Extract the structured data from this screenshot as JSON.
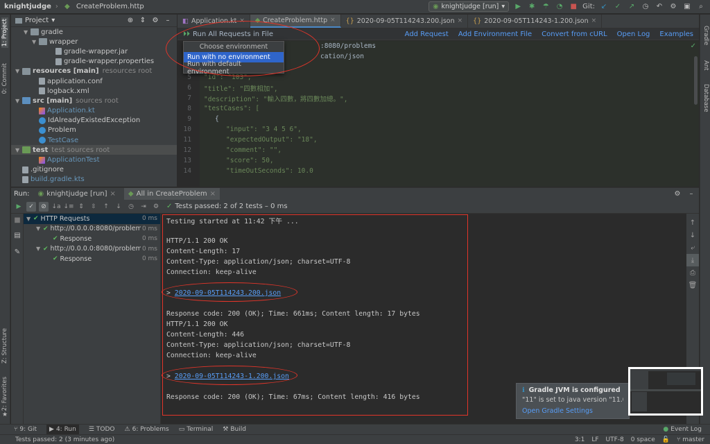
{
  "navbar": {
    "project": "knightjudge",
    "file": "CreateProblem.http",
    "run_config": "knightjudge [run]",
    "git_label": "Git:"
  },
  "left_stripe": {
    "project": "1: Project",
    "commit": "0: Commit",
    "structure": "Z: Structure",
    "favorites": "2: Favorites"
  },
  "right_stripe": {
    "gradle": "Gradle",
    "ant": "Ant",
    "database": "Database"
  },
  "project_panel": {
    "title": "Project",
    "items": [
      {
        "indent": 1,
        "arrow": "▼",
        "icon": "folder",
        "label": "gradle",
        "sub": ""
      },
      {
        "indent": 2,
        "arrow": "▼",
        "icon": "folder",
        "label": "wrapper",
        "sub": ""
      },
      {
        "indent": 4,
        "arrow": "",
        "icon": "file",
        "label": "gradle-wrapper.jar",
        "sub": ""
      },
      {
        "indent": 4,
        "arrow": "",
        "icon": "file",
        "label": "gradle-wrapper.properties",
        "sub": ""
      },
      {
        "indent": 0,
        "arrow": "▼",
        "icon": "folder",
        "label": "resources [main]",
        "sub": "resources root",
        "bold": true
      },
      {
        "indent": 2,
        "arrow": "",
        "icon": "file",
        "label": "application.conf",
        "sub": ""
      },
      {
        "indent": 2,
        "arrow": "",
        "icon": "file",
        "label": "logback.xml",
        "sub": ""
      },
      {
        "indent": 0,
        "arrow": "▼",
        "icon": "folder-blue",
        "label": "src [main]",
        "sub": "sources root",
        "bold": true
      },
      {
        "indent": 2,
        "arrow": "",
        "icon": "kt",
        "label": "Application.kt",
        "sub": "",
        "blue": true
      },
      {
        "indent": 2,
        "arrow": "",
        "icon": "class",
        "label": "IdAlreadyExistedException",
        "sub": ""
      },
      {
        "indent": 2,
        "arrow": "",
        "icon": "class",
        "label": "Problem",
        "sub": ""
      },
      {
        "indent": 2,
        "arrow": "",
        "icon": "class",
        "label": "TestCase",
        "sub": "",
        "blue": true
      },
      {
        "indent": 0,
        "arrow": "▼",
        "icon": "folder-green",
        "label": "test",
        "sub": "test sources root",
        "bold": true,
        "selected": true
      },
      {
        "indent": 2,
        "arrow": "",
        "icon": "kt",
        "label": "ApplicationTest",
        "sub": "",
        "blue": true
      },
      {
        "indent": 0,
        "arrow": "",
        "icon": "file",
        "label": ".gitignore",
        "sub": ""
      },
      {
        "indent": 0,
        "arrow": "",
        "icon": "file",
        "label": "build.gradle.kts",
        "sub": "",
        "blue": true
      }
    ]
  },
  "editor": {
    "tabs": [
      {
        "label": "Application.kt",
        "active": false
      },
      {
        "label": "CreateProblem.http",
        "active": true
      },
      {
        "label": "2020-09-05T114243.200.json",
        "active": false
      },
      {
        "label": "2020-09-05T114243-1.200.json",
        "active": false
      }
    ],
    "http_toolbar": {
      "run_all": "Run All Requests in File",
      "links": [
        "Add Request",
        "Add Environment File",
        "Convert from cURL",
        "Open Log",
        "Examples"
      ]
    },
    "lines": [
      {
        "n": "",
        "text": ":8080/problems",
        "cls": "p",
        "indent": 176
      },
      {
        "n": "",
        "text": "cation/json",
        "cls": "p",
        "indent": 176
      },
      {
        "n": "",
        "text": "",
        "cls": "p",
        "indent": 0
      },
      {
        "n": "5",
        "text": "\"id\": \"103\",",
        "cls": "s",
        "indent": 8
      },
      {
        "n": "6",
        "text": "\"title\": \"四數相加\",",
        "cls": "s",
        "indent": 8
      },
      {
        "n": "7",
        "text": "\"description\": \"輸入四數，將四數加總。\",",
        "cls": "s",
        "indent": 8
      },
      {
        "n": "8",
        "text": "\"testCases\": [",
        "cls": "s",
        "indent": 8
      },
      {
        "n": "9",
        "text": "{",
        "cls": "p",
        "indent": 24
      },
      {
        "n": "10",
        "text": "\"input\": \"3 4 5 6\",",
        "cls": "s",
        "indent": 40
      },
      {
        "n": "11",
        "text": "\"expectedOutput\": \"18\",",
        "cls": "s",
        "indent": 40
      },
      {
        "n": "12",
        "text": "\"comment\": \"\",",
        "cls": "s",
        "indent": 40
      },
      {
        "n": "13",
        "text": "\"score\": 50,",
        "cls": "s",
        "indent": 40
      },
      {
        "n": "14",
        "text": "\"timeOutSeconds\": 10.0",
        "cls": "s",
        "indent": 40
      }
    ],
    "dropdown": {
      "header": "Choose environment",
      "options": [
        "Run with no environment",
        "Run with default environment"
      ]
    }
  },
  "run_panel": {
    "label": "Run:",
    "tabs": [
      "knightjudge [run]",
      "All in CreateProblem"
    ],
    "status": "Tests passed: 2 of 2 tests – 0 ms",
    "tree": [
      {
        "indent": 0,
        "label": "HTTP Requests",
        "time": "0 ms",
        "selected": true,
        "arrow": "▼"
      },
      {
        "indent": 1,
        "label": "http://0.0.0.0:8080/problem",
        "time": "0 ms",
        "arrow": "▼"
      },
      {
        "indent": 2,
        "label": "Response",
        "time": "0 ms",
        "arrow": ""
      },
      {
        "indent": 1,
        "label": "http://0.0.0.0:8080/problem",
        "time": "0 ms",
        "arrow": "▼"
      },
      {
        "indent": 2,
        "label": "Response",
        "time": "0 ms",
        "arrow": ""
      }
    ],
    "console": [
      {
        "text": "Testing started at 11:42 下午 ...",
        "link": ""
      },
      {
        "text": "",
        "link": ""
      },
      {
        "text": "HTTP/1.1 200 OK",
        "link": ""
      },
      {
        "text": "Content-Length: 17",
        "link": ""
      },
      {
        "text": "Content-Type: application/json; charset=UTF-8",
        "link": ""
      },
      {
        "text": "Connection: keep-alive",
        "link": ""
      },
      {
        "text": "",
        "link": ""
      },
      {
        "text": "> ",
        "link": "2020-09-05T114243.200.json"
      },
      {
        "text": "",
        "link": ""
      },
      {
        "text": "Response code: 200 (OK); Time: 661ms; Content length: 17 bytes",
        "link": ""
      },
      {
        "text": "HTTP/1.1 200 OK",
        "link": ""
      },
      {
        "text": "Content-Length: 446",
        "link": ""
      },
      {
        "text": "Content-Type: application/json; charset=UTF-8",
        "link": ""
      },
      {
        "text": "Connection: keep-alive",
        "link": ""
      },
      {
        "text": "",
        "link": ""
      },
      {
        "text": "> ",
        "link": "2020-09-05T114243-1.200.json"
      },
      {
        "text": "",
        "link": ""
      },
      {
        "text": "Response code: 200 (OK); Time: 67ms; Content length: 416 bytes",
        "link": ""
      }
    ]
  },
  "notification": {
    "title": "Gradle JVM is configured",
    "body": "\"11\" is set to java version \"11.0.",
    "link": "Open Gradle Settings"
  },
  "toolwindows": {
    "items": [
      "9: Git",
      "4: Run",
      "TODO",
      "6: Problems",
      "Terminal",
      "Build"
    ],
    "event_log": "Event Log"
  },
  "statusbar": {
    "message": "Tests passed: 2 (3 minutes ago)",
    "position": "3:1",
    "line_sep": "LF",
    "encoding": "UTF-8",
    "indent": "0 space",
    "branch": "master"
  },
  "colors": {
    "accent": "#4a88c7",
    "link": "#589df6",
    "annotation": "#e2352a",
    "success": "#5fb95f"
  }
}
